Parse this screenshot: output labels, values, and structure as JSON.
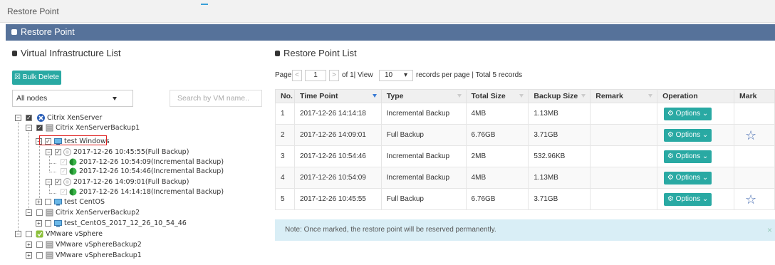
{
  "page": {
    "title": "Restore Point"
  },
  "panel": {
    "title": "Restore Point"
  },
  "left": {
    "title": "Virtual Infrastructure List",
    "bulk_delete": "Bulk Delete",
    "node_select": "All nodes",
    "search_placeholder": "Search by VM name.."
  },
  "tree": [
    {
      "label": "Citrix XenServer"
    },
    {
      "label": "Citrix XenServerBackup1"
    },
    {
      "label": "test Windows"
    },
    {
      "label": "2017-12-26 10:45:55(Full Backup)"
    },
    {
      "label": "2017-12-26 10:54:09(Incremental Backup)"
    },
    {
      "label": "2017-12-26 10:54:46(Incremental Backup)"
    },
    {
      "label": "2017-12-26 14:09:01(Full Backup)"
    },
    {
      "label": "2017-12-26 14:14:18(Incremental Backup)"
    },
    {
      "label": "test CentOS"
    },
    {
      "label": "Citrix XenServerBackup2"
    },
    {
      "label": "test_CentOS_2017_12_26_10_54_46"
    },
    {
      "label": "VMware vSphere"
    },
    {
      "label": "VMware vSphereBackup2"
    },
    {
      "label": "VMware vSphereBackup1"
    }
  ],
  "right": {
    "title": "Restore Point List",
    "pager": {
      "page_label": "Page",
      "prev": "<",
      "page_value": "1",
      "next": ">",
      "of_view": "of 1| View",
      "per_page": "10",
      "records_text": "records per page | Total 5 records"
    },
    "columns": [
      "No.",
      "Time Point",
      "Type",
      "Total Size",
      "Backup Size",
      "Remark",
      "Operation",
      "Mark"
    ],
    "options_label": "Options",
    "rows": [
      {
        "no": "1",
        "time": "2017-12-26 14:14:18",
        "type": "Incremental Backup",
        "total": "4MB",
        "backup": "1.13MB",
        "remark": "",
        "marked": false
      },
      {
        "no": "2",
        "time": "2017-12-26 14:09:01",
        "type": "Full Backup",
        "total": "6.76GB",
        "backup": "3.71GB",
        "remark": "",
        "marked": true
      },
      {
        "no": "3",
        "time": "2017-12-26 10:54:46",
        "type": "Incremental Backup",
        "total": "2MB",
        "backup": "532.96KB",
        "remark": "",
        "marked": false
      },
      {
        "no": "4",
        "time": "2017-12-26 10:54:09",
        "type": "Incremental Backup",
        "total": "4MB",
        "backup": "1.13MB",
        "remark": "",
        "marked": false
      },
      {
        "no": "5",
        "time": "2017-12-26 10:45:55",
        "type": "Full Backup",
        "total": "6.76GB",
        "backup": "3.71GB",
        "remark": "",
        "marked": true
      }
    ],
    "note": "Note: Once marked, the restore point will be reserved permanently.",
    "note_close": "×"
  },
  "colors": {
    "header": "#56729a",
    "teal": "#29a9a3",
    "star": "#4a6fb3",
    "highlight": "#e02020",
    "note_bg": "#d9eef6"
  }
}
